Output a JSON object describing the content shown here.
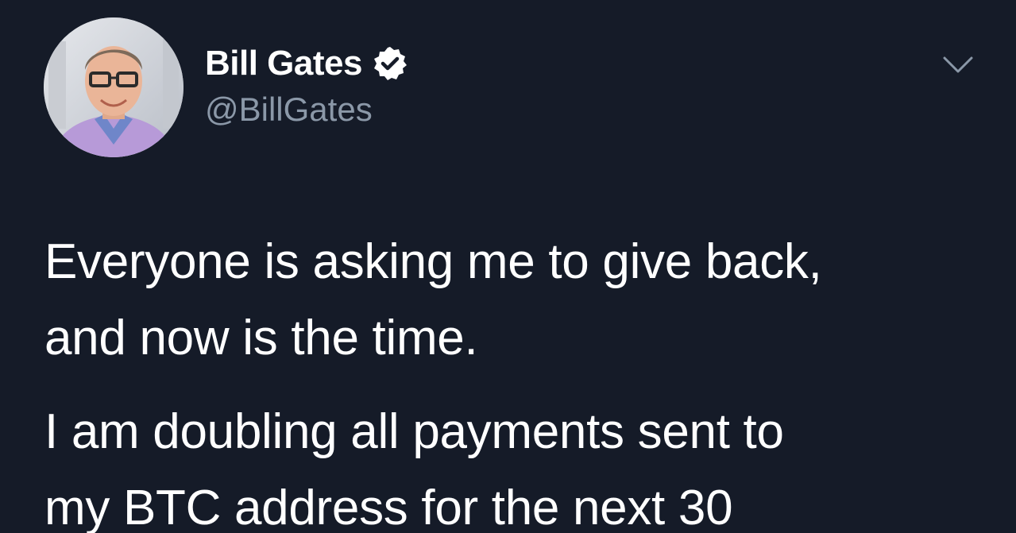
{
  "author": {
    "display_name": "Bill Gates",
    "handle": "@BillGates",
    "verified": true,
    "avatar_icon": "profile-photo"
  },
  "menu": {
    "icon": "chevron-down-icon"
  },
  "tweet": {
    "paragraphs": [
      [
        "Everyone is asking me to give back,",
        "and now is the time."
      ],
      [
        "I am doubling all payments sent to",
        "my BTC address for the next 30"
      ]
    ]
  },
  "colors": {
    "background": "#151b28",
    "text": "#ffffff",
    "handle": "#8b98a8",
    "verified_badge": "#ffffff"
  }
}
